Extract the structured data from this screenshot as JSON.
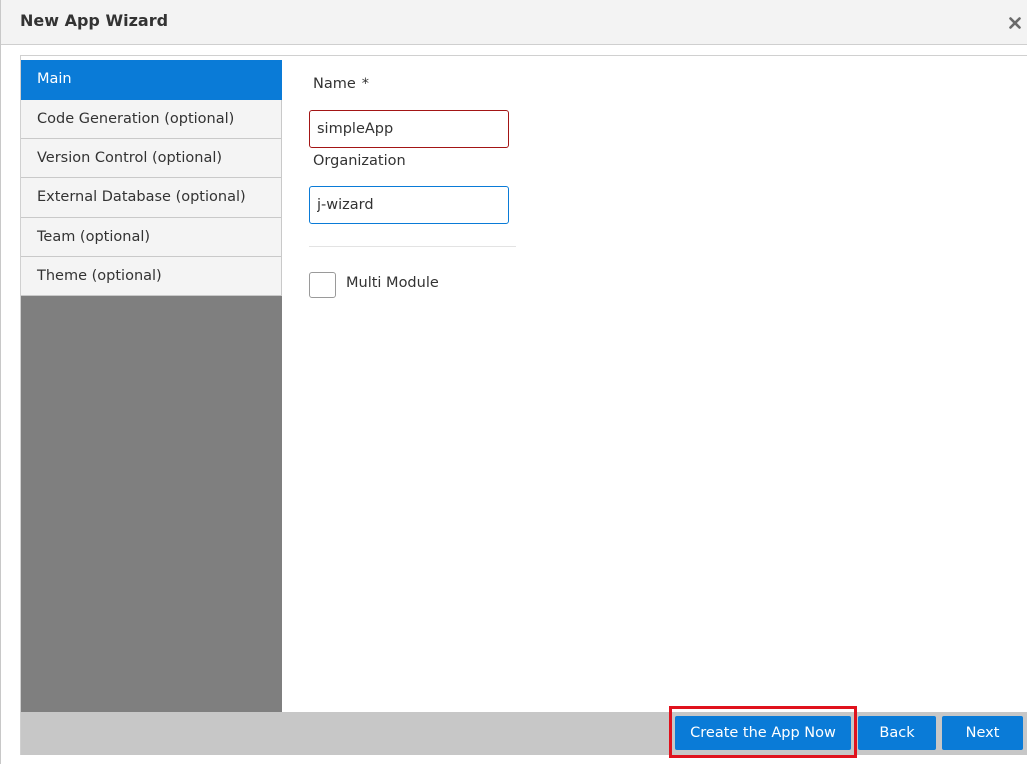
{
  "window": {
    "title": "New App Wizard",
    "close_icon": "close-icon"
  },
  "sidebar": {
    "items": [
      {
        "label": "Main",
        "active": true
      },
      {
        "label": "Code Generation (optional)",
        "active": false
      },
      {
        "label": "Version Control (optional)",
        "active": false
      },
      {
        "label": "External Database (optional)",
        "active": false
      },
      {
        "label": "Team (optional)",
        "active": false
      },
      {
        "label": "Theme (optional)",
        "active": false
      }
    ]
  },
  "form": {
    "name_label": "Name",
    "required_marker": "*",
    "name_value": "simpleApp",
    "organization_label": "Organization",
    "organization_value": "j-wizard",
    "multi_module_label": "Multi Module",
    "multi_module_checked": false
  },
  "footer": {
    "create_label": "Create the App Now",
    "back_label": "Back",
    "next_label": "Next"
  },
  "colors": {
    "accent": "#0a7bd7",
    "error_border": "#a31515",
    "highlight": "#e0121d",
    "sidebar_bg": "#7f7f7f",
    "footer_bg": "#c7c7c7"
  }
}
